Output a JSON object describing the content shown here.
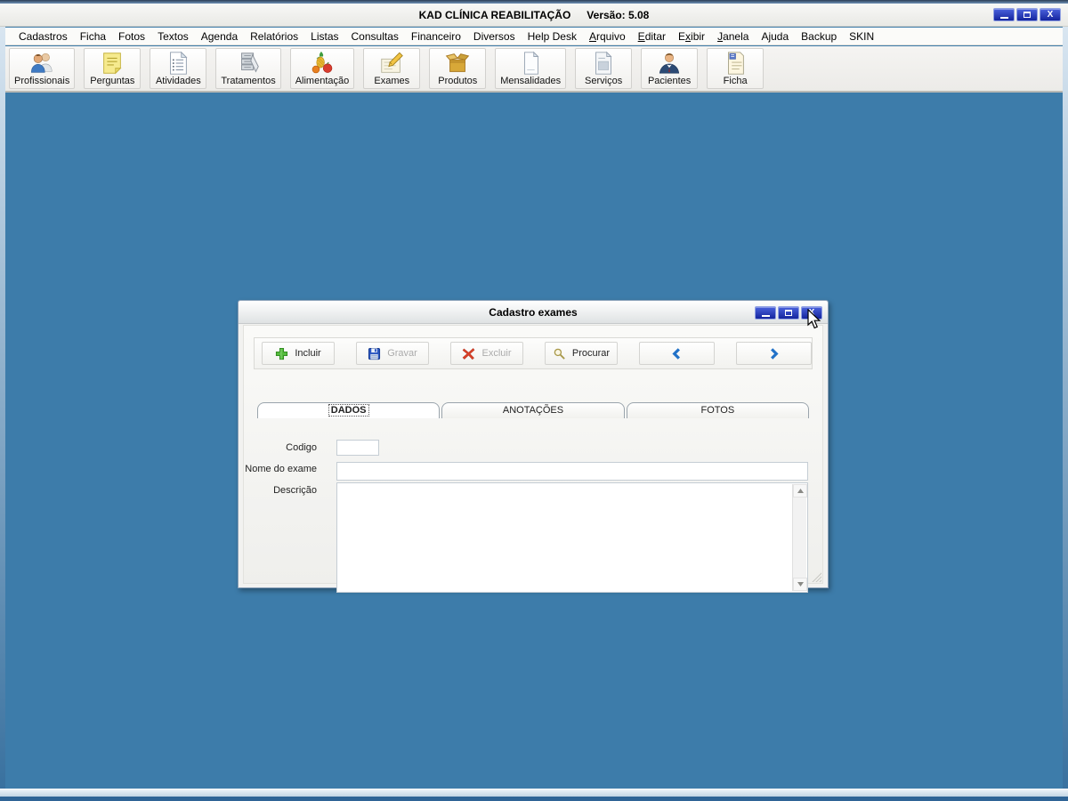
{
  "window": {
    "title": "KAD CLÍNICA REABILITAÇÃO",
    "version_label": "Versão: 5.08"
  },
  "menu": {
    "items": [
      {
        "label": "Cadastros"
      },
      {
        "label": "Ficha"
      },
      {
        "label": "Fotos"
      },
      {
        "label": "Textos"
      },
      {
        "label": "Agenda"
      },
      {
        "label": "Relatórios"
      },
      {
        "label": "Listas"
      },
      {
        "label": "Consultas"
      },
      {
        "label": "Financeiro"
      },
      {
        "label": "Diversos"
      },
      {
        "label": "Help Desk"
      },
      {
        "label": "Arquivo",
        "underline": 0
      },
      {
        "label": "Editar",
        "underline": 0
      },
      {
        "label": "Exibir",
        "underline": 1
      },
      {
        "label": "Janela",
        "underline": 0
      },
      {
        "label": "Ajuda"
      },
      {
        "label": "Backup"
      },
      {
        "label": "SKIN"
      }
    ]
  },
  "toolbar": {
    "buttons": [
      {
        "label": "Profissionais",
        "icon": "professionals-icon"
      },
      {
        "label": "Perguntas",
        "icon": "questions-note-icon"
      },
      {
        "label": "Atividades",
        "icon": "activities-notepad-icon"
      },
      {
        "label": "Tratamentos",
        "icon": "treatments-cabinet-icon"
      },
      {
        "label": "Alimentação",
        "icon": "food-fruits-icon"
      },
      {
        "label": "Exames",
        "icon": "exams-pencil-icon"
      },
      {
        "label": "Produtos",
        "icon": "products-box-icon"
      },
      {
        "label": "Mensalidades",
        "icon": "monthly-sheet-icon"
      },
      {
        "label": "Serviços",
        "icon": "services-document-icon"
      },
      {
        "label": "Pacientes",
        "icon": "patients-person-icon"
      },
      {
        "label": "Ficha",
        "icon": "record-sheet-icon"
      }
    ]
  },
  "dialog": {
    "title": "Cadastro exames",
    "toolbar": {
      "buttons": [
        {
          "label": "Incluir",
          "icon": "add-plus-icon",
          "enabled": true,
          "name": "incluir-button"
        },
        {
          "label": "Gravar",
          "icon": "save-floppy-icon",
          "enabled": false,
          "name": "gravar-button"
        },
        {
          "label": "Excluir",
          "icon": "delete-x-icon",
          "enabled": false,
          "name": "excluir-button"
        },
        {
          "label": "Procurar",
          "icon": "search-magnifier-icon",
          "enabled": true,
          "name": "procurar-button"
        },
        {
          "label": "",
          "icon": "arrow-left-icon",
          "enabled": true,
          "name": "previous-record-button"
        },
        {
          "label": "",
          "icon": "arrow-right-icon",
          "enabled": true,
          "name": "next-record-button"
        }
      ]
    },
    "tabs": [
      {
        "label": "DADOS",
        "active": true
      },
      {
        "label": "ANOTAÇÕES",
        "active": false
      },
      {
        "label": "FOTOS",
        "active": false
      }
    ],
    "form": {
      "code_label": "Codigo",
      "code_value": "",
      "name_label": "Nome do exame",
      "name_value": "",
      "description_label": "Descrição",
      "description_value": ""
    }
  },
  "colors": {
    "mdi_background": "#3d7caa",
    "control_button_blue": "#15259e",
    "accent_chevron_blue": "#2272c8",
    "add_green": "#52b83c",
    "delete_red": "#d83020"
  }
}
